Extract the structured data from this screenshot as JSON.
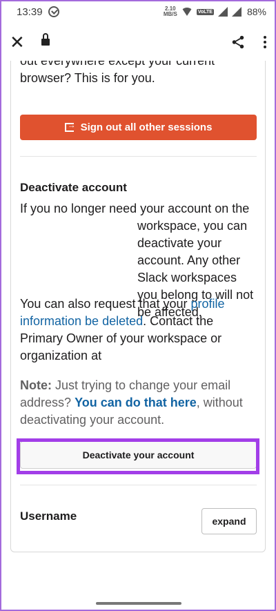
{
  "status_bar": {
    "time": "13:39",
    "speed_value": "2.10",
    "speed_unit": "MB/S",
    "volte": "VoLTE",
    "battery": "88%"
  },
  "toolbar": {
    "close_icon": "close-icon",
    "lock_icon": "lock-icon",
    "share_icon": "share-icon",
    "menu_icon": "kebab-icon"
  },
  "sessions": {
    "intro_text": "out everywhere except your current browser? This is for you.",
    "signout_button": "Sign out all other sessions"
  },
  "deactivate": {
    "heading": "Deactivate account",
    "para1_line1": "If you no longer need your account on the",
    "para1_rest": "workspace, you can deactivate your account. Any other Slack workspaces you belong to will not be affected.",
    "para2_prefix": "You can also request that your ",
    "para2_link": "profile information be deleted",
    "para2_suffix": ". Contact the Primary Owner of your workspace or organization at",
    "note_label": "Note:",
    "note_prefix": " Just trying to change your email address? ",
    "note_link": "You can do that here",
    "note_suffix": ", without deactivating your account.",
    "button": "Deactivate your account"
  },
  "username": {
    "label": "Username",
    "expand_button": "expand"
  },
  "colors": {
    "signout_button": "#e0522f",
    "link": "#1264a3",
    "highlight": "#a23ee8"
  }
}
